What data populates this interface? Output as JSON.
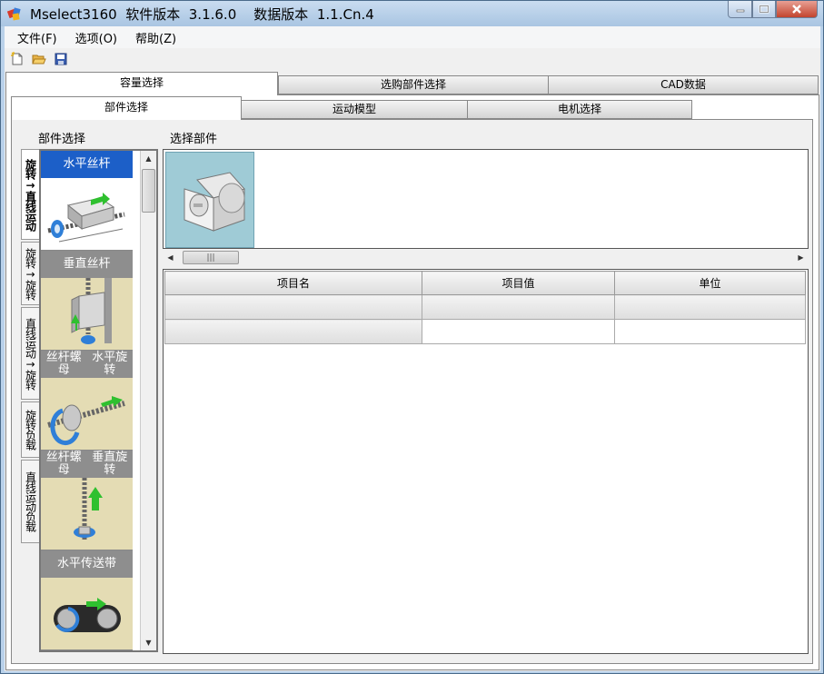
{
  "window": {
    "title": "Mselect3160  软件版本  3.1.6.0    数据版本  1.1.Cn.4"
  },
  "menu": [
    {
      "label": "文件(F)"
    },
    {
      "label": "选项(O)"
    },
    {
      "label": "帮助(Z)"
    }
  ],
  "toolbar": {
    "icons": [
      "new-file-icon",
      "open-folder-icon",
      "save-icon"
    ]
  },
  "outer_tabs": [
    {
      "label": "容量选择",
      "active": true
    },
    {
      "label": "选购部件选择",
      "active": false
    },
    {
      "label": "CAD数据",
      "active": false
    }
  ],
  "inner_tabs": [
    {
      "label": "部件选择",
      "active": true
    },
    {
      "label": "运动模型",
      "active": false
    },
    {
      "label": "电机选择",
      "active": false
    }
  ],
  "part_selection": {
    "heading": "部件选择",
    "side_tabs": [
      {
        "label": "旋转→直线运动",
        "active": true
      },
      {
        "label": "旋转→旋转",
        "active": false
      },
      {
        "label": "直线运动→旋转",
        "active": false
      },
      {
        "label": "旋转负载",
        "active": false
      },
      {
        "label": "直线运动负载",
        "active": false
      }
    ],
    "components": [
      {
        "title": "水平丝杆",
        "active": true
      },
      {
        "title": "垂直丝杆",
        "active": false
      },
      {
        "title": "丝杆螺母水平旋转",
        "title_line1": "丝杆螺母",
        "title_line2": "水平旋转",
        "active": false
      },
      {
        "title": "丝杆螺母垂直旋转",
        "title_line1": "丝杆螺母",
        "title_line2": "垂直旋转",
        "active": false
      },
      {
        "title": "水平传送带",
        "active": false
      }
    ]
  },
  "selected_parts": {
    "heading": "选择部件"
  },
  "property_grid": {
    "columns": [
      "项目名",
      "项目值",
      "单位"
    ],
    "rows": [
      [
        "",
        "",
        ""
      ],
      [
        "",
        "",
        ""
      ]
    ]
  },
  "colors": {
    "active_component": "#1c5fc8",
    "inactive_component": "#8e8e8e",
    "component_background": "#e4dcb4",
    "selected_part_background": "#9fcbd6"
  }
}
